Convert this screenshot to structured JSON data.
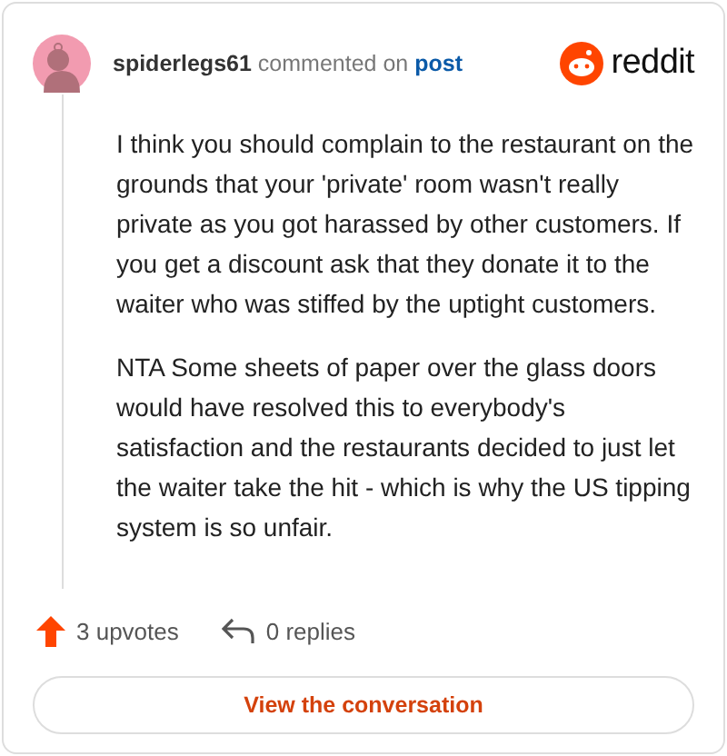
{
  "comment": {
    "author": "spiderlegs61",
    "action": "commented on",
    "link": "post",
    "paragraphs": [
      "I think you should complain to the restaurant on the grounds that your 'private' room wasn't really private as you got harassed by other customers. If you get a discount ask that they donate it to the waiter who was stiffed by the uptight customers.",
      "NTA Some sheets of paper over the glass doors would have resolved this to everybody's satisfaction and the restaurants decided to just let the waiter take the hit - which is why the US tipping system is so unfair."
    ],
    "upvotes": "3 upvotes",
    "upvoted": true,
    "replies": "0 replies"
  },
  "brand": "reddit",
  "button": "View the conversation"
}
